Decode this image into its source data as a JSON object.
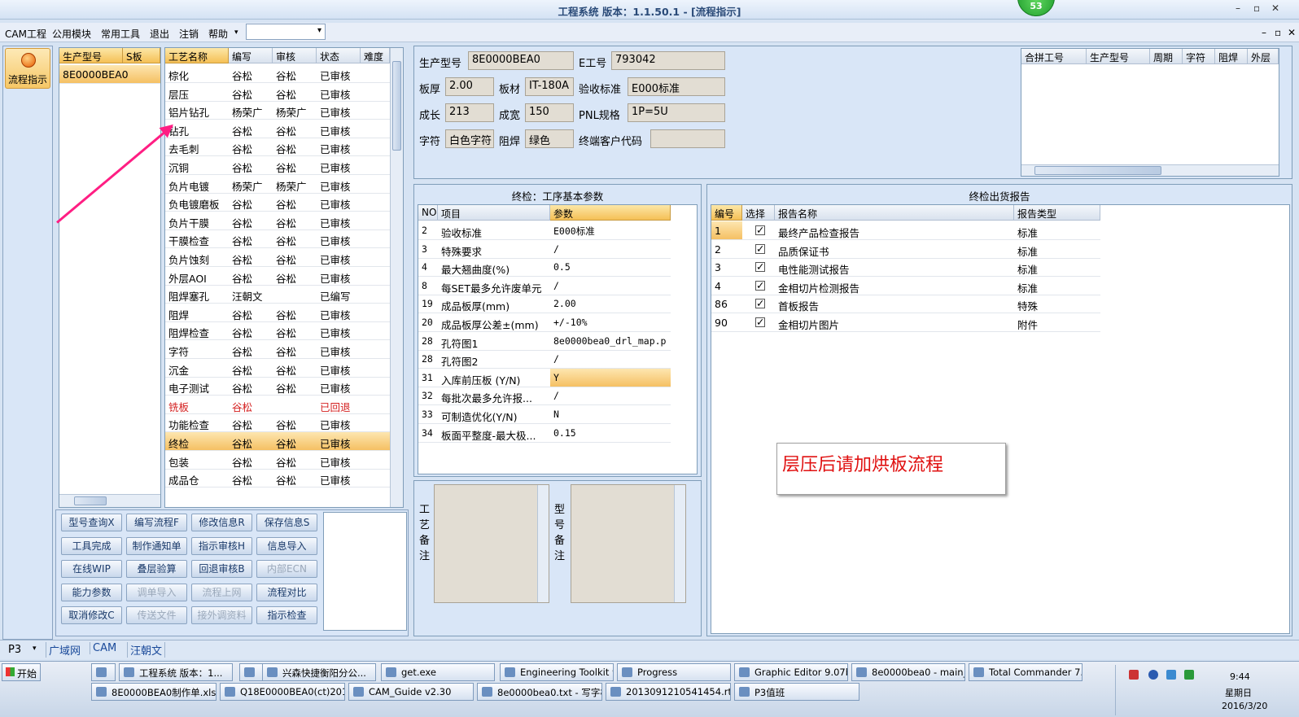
{
  "window": {
    "title": "工程系统  版本：1.1.50.1 - [流程指示]",
    "badge": "53",
    "min": "–",
    "restore": "▫",
    "close": "✕"
  },
  "menu": {
    "items": [
      "CAM工程",
      "公用模块",
      "常用工具",
      "退出",
      "注销",
      "帮助"
    ],
    "help_arrow": "▾",
    "combo_value": "",
    "wc_min": "–",
    "wc_restore": "▫",
    "wc_close": "✕"
  },
  "left_nav": {
    "flow_label": "流程指示"
  },
  "model_list": {
    "headers": [
      "生产型号",
      "S板"
    ],
    "rows": [
      "8E0000BEA0"
    ]
  },
  "process_list": {
    "headers": [
      "工艺名称",
      "编写",
      "审核",
      "状态",
      "难度"
    ],
    "rows": [
      [
        "棕化",
        "谷松",
        "谷松",
        "已审核"
      ],
      [
        "层压",
        "谷松",
        "谷松",
        "已审核"
      ],
      [
        "铝片钻孔",
        "杨荣广",
        "杨荣广",
        "已审核"
      ],
      [
        "钻孔",
        "谷松",
        "谷松",
        "已审核"
      ],
      [
        "去毛刺",
        "谷松",
        "谷松",
        "已审核"
      ],
      [
        "沉铜",
        "谷松",
        "谷松",
        "已审核"
      ],
      [
        "负片电镀",
        "杨荣广",
        "杨荣广",
        "已审核"
      ],
      [
        "负电镀磨板",
        "谷松",
        "谷松",
        "已审核"
      ],
      [
        "负片干膜",
        "谷松",
        "谷松",
        "已审核"
      ],
      [
        "干膜检查",
        "谷松",
        "谷松",
        "已审核"
      ],
      [
        "负片蚀刻",
        "谷松",
        "谷松",
        "已审核"
      ],
      [
        "外层AOI",
        "谷松",
        "谷松",
        "已审核"
      ],
      [
        "阻焊塞孔",
        "汪朝文",
        "",
        "已编写"
      ],
      [
        "阻焊",
        "谷松",
        "谷松",
        "已审核"
      ],
      [
        "阻焊检查",
        "谷松",
        "谷松",
        "已审核"
      ],
      [
        "字符",
        "谷松",
        "谷松",
        "已审核"
      ],
      [
        "沉金",
        "谷松",
        "谷松",
        "已审核"
      ],
      [
        "电子测试",
        "谷松",
        "谷松",
        "已审核"
      ],
      [
        "铣板",
        "谷松",
        "",
        "已回退"
      ],
      [
        "功能检查",
        "谷松",
        "谷松",
        "已审核"
      ],
      [
        "终检",
        "谷松",
        "谷松",
        "已审核"
      ],
      [
        "包装",
        "谷松",
        "谷松",
        "已审核"
      ],
      [
        "成品仓",
        "谷松",
        "谷松",
        "已审核"
      ]
    ]
  },
  "buttons": [
    [
      "型号查询X",
      "编写流程F",
      "修改信息R",
      "保存信息S"
    ],
    [
      "工具完成",
      "制作通知单",
      "指示审核H",
      "信息导入"
    ],
    [
      "在线WIP",
      "叠层验算",
      "回退审核B",
      "内部ECN"
    ],
    [
      "能力参数",
      "调单导入",
      "流程上网",
      "流程对比"
    ],
    [
      "取消修改C",
      "传送文件",
      "接外调资料",
      "指示检查"
    ]
  ],
  "info": {
    "labels": {
      "model": "生产型号",
      "eno": "E工号",
      "thick": "板厚",
      "material": "板材",
      "accept": "验收标准",
      "length": "成长",
      "width": "成宽",
      "pnl": "PNL规格",
      "char": "字符",
      "mask": "阻焊",
      "cust": "终端客户代码"
    },
    "values": {
      "model": "8E0000BEA0",
      "eno": "793042",
      "thick": "2.00",
      "material": "IT-180A",
      "accept": "E000标准",
      "length": "213",
      "width": "150",
      "pnl": "1P=5U",
      "char": "白色字符",
      "mask": "绿色",
      "cust": ""
    }
  },
  "merge_table": {
    "headers": [
      "合拼工号",
      "生产型号",
      "周期",
      "字符",
      "阻焊",
      "外层"
    ]
  },
  "params": {
    "title": "终检：工序基本参数",
    "headers": [
      "NO",
      "项目",
      "参数"
    ],
    "rows": [
      [
        "2",
        "验收标准",
        "E000标准"
      ],
      [
        "3",
        "特殊要求",
        "/"
      ],
      [
        "4",
        "最大翘曲度(%)",
        "0.5"
      ],
      [
        "8",
        "每SET最多允许废单元",
        "/"
      ],
      [
        "19",
        "成品板厚(mm)",
        "2.00"
      ],
      [
        "20",
        "成品板厚公差±(mm)",
        "+/-10%"
      ],
      [
        "28",
        "孔符图1",
        "8e0000bea0_drl_map.p"
      ],
      [
        "28",
        "孔符图2",
        "/"
      ],
      [
        "31",
        "入库前压板 (Y/N)",
        "Y"
      ],
      [
        "32",
        "每批次最多允许报...",
        "/"
      ],
      [
        "33",
        "可制造优化(Y/N)",
        "N"
      ],
      [
        "34",
        "板面平整度-最大极...",
        "0.15"
      ]
    ]
  },
  "report": {
    "title": "终检出货报告",
    "headers": [
      "编号",
      "选择",
      "报告名称",
      "报告类型"
    ],
    "rows": [
      [
        "1",
        "✓",
        "最终产品检查报告",
        "标准"
      ],
      [
        "2",
        "✓",
        "品质保证书",
        "标准"
      ],
      [
        "3",
        "✓",
        "电性能测试报告",
        "标准"
      ],
      [
        "4",
        "✓",
        "金相切片检测报告",
        "标准"
      ],
      [
        "86",
        "✓",
        "首板报告",
        "特殊"
      ],
      [
        "90",
        "✓",
        "金相切片图片",
        "附件"
      ]
    ]
  },
  "notes": {
    "process": [
      "工",
      "艺",
      "备",
      "注"
    ],
    "model": [
      "型",
      "号",
      "备",
      "注"
    ]
  },
  "annotation": "层压后请加烘板流程",
  "status": {
    "p3": "P3",
    "arrow": "▾",
    "items": [
      "广域网",
      "CAM",
      "汪朝文"
    ]
  },
  "taskbar": {
    "start": "开始",
    "row1": [
      "",
      "工程系统  版本：1...",
      "",
      "兴森快捷衡阳分公...",
      "get.exe",
      "Engineering Toolkit 9....",
      "Progress",
      "Graphic Editor 9.07b2...",
      "8e0000bea0 - main_qa",
      "Total Commander 7.0 ..."
    ],
    "row2": [
      "8E0000BEA0制作单.xls ...",
      "Q18E0000BEA0(ct)2016-...",
      "CAM_Guide v2.30",
      "8e0000bea0.txt - 写字板",
      "2013091210541454.rtf [...",
      "P3值班"
    ],
    "time": "9:44",
    "weekday": "星期日",
    "date": "2016/3/20"
  }
}
